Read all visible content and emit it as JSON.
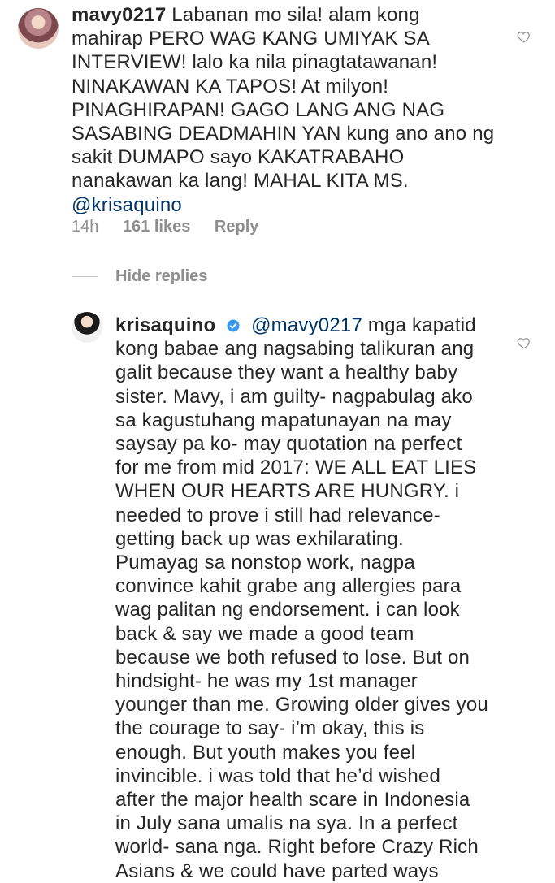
{
  "comment1": {
    "username": "mavy0217",
    "first_line": "Labanan mo sila! alam kong",
    "lines": [
      "mahirap PERO WAG KANG UMIYAK SA",
      "INTERVIEW! lalo ka nila pinagtatawanan!",
      "NINAKAWAN KA TAPOS! At milyon!",
      "PINAGHIRAPAN! GAGO LANG ANG NAG",
      "SASABING DEADMAHIN YAN kung ano ano ng",
      "sakit DUMAPO sayo KAKATRABAHO",
      "nanakawan ka lang! MAHAL KITA MS."
    ],
    "mention": "@krisaquino",
    "time": "14h",
    "likes": "161 likes",
    "reply_label": "Reply",
    "hide_replies_label": "Hide replies"
  },
  "comment2": {
    "username": "krisaquino",
    "mention": "@mavy0217",
    "first_line": "mga kapatid",
    "lines": [
      "kong babae ang nagsabing talikuran ang",
      "galit because they want a healthy baby",
      "sister. Mavy, i am guilty- nagpabulag ako",
      "sa kagustuhang mapatunayan na may",
      "saysay pa ko- may quotation na perfect",
      "for me from mid 2017: WE ALL EAT LIES",
      "WHEN OUR HEARTS ARE HUNGRY. i",
      "needed to prove i still had relevance-",
      "getting back up was exhilarating.",
      "Pumayag sa nonstop work, nagpa",
      "convince kahit grabe ang allergies para",
      "wag palitan ng endorsement. i can look",
      "back & say we made a good team",
      "because we both refused to lose. But on",
      "hindsight- he was my 1st manager",
      "younger than me. Growing older gives you",
      "the courage to say- i’m okay, this is",
      "enough. But youth makes you feel",
      "invincible. i was told that he’d wished",
      "after the major health scare in Indonesia",
      "in July sana umalis na sya. In a perfect",
      "world- sana nga. Right before Crazy Rich",
      "Asians & we could have parted ways"
    ]
  },
  "icons": {
    "heart": "heart-outline-icon",
    "verified": "verified-badge-icon"
  },
  "colors": {
    "text": "#262626",
    "muted": "#8e8e8e",
    "mention": "#003569",
    "verified": "#3897f0"
  }
}
